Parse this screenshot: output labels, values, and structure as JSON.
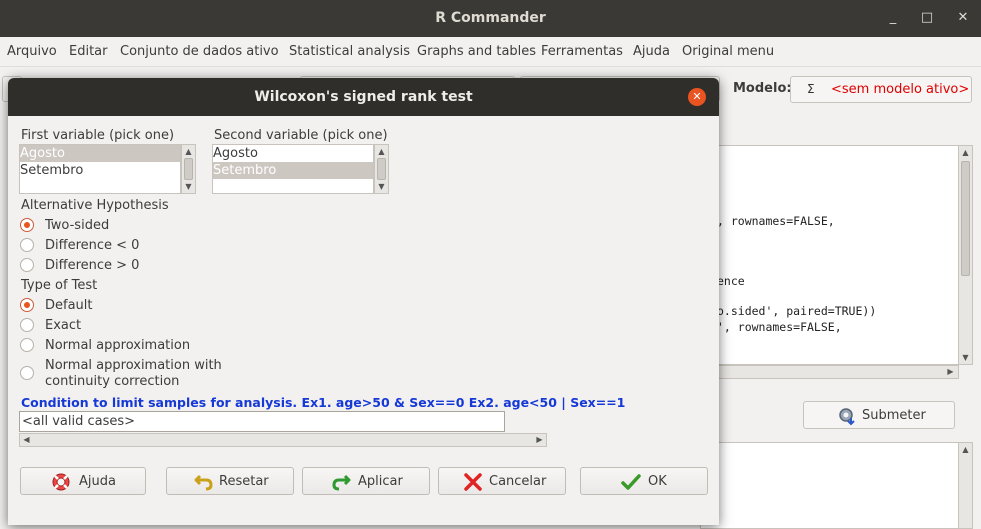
{
  "window": {
    "title": "R Commander",
    "minimize": "_",
    "maximize": "□",
    "close": "✕"
  },
  "menu": [
    "Arquivo",
    "Editar",
    "Conjunto de dados ativo",
    "Statistical analysis",
    "Graphs and tables",
    "Ferramentas",
    "Ajuda",
    "Original menu"
  ],
  "toolbar": {
    "modelo_label": "Modelo:",
    "modelo_icon": "Σ",
    "modelo_value": "<sem modelo ativo>"
  },
  "script_lines": [
    ", rownames=FALSE,",
    "ence",
    "o.sided', paired=TRUE))",
    "', rownames=FALSE,"
  ],
  "submeter_label": "Submeter",
  "dialog": {
    "title": "Wilcoxon's signed rank test",
    "first_var_label": "First variable (pick one)",
    "first_var_items": [
      "Agosto",
      "Setembro"
    ],
    "first_var_selected": "Agosto",
    "second_var_label": "Second variable (pick one)",
    "second_var_items": [
      "Agosto",
      "Setembro"
    ],
    "second_var_selected": "Setembro",
    "alt_hyp_label": "Alternative Hypothesis",
    "alt_hyp_options": [
      "Two-sided",
      "Difference < 0",
      "Difference > 0"
    ],
    "alt_hyp_selected": "Two-sided",
    "test_type_label": "Type of Test",
    "test_type_options": [
      "Default",
      "Exact",
      "Normal approximation",
      "Normal approximation with",
      "continuity correction"
    ],
    "test_type_selected": "Default",
    "condition_label": "Condition to limit samples for analysis. Ex1. age>50 & Sex==0  Ex2. age<50 | Sex==1",
    "condition_value": "<all valid cases>",
    "buttons": {
      "help": "Ajuda",
      "reset": "Resetar",
      "apply": "Aplicar",
      "cancel": "Cancelar",
      "ok": "OK"
    }
  },
  "colors": {
    "accent": "#e95420",
    "condition_text": "#1538d6",
    "modelo_text": "#e00000"
  }
}
